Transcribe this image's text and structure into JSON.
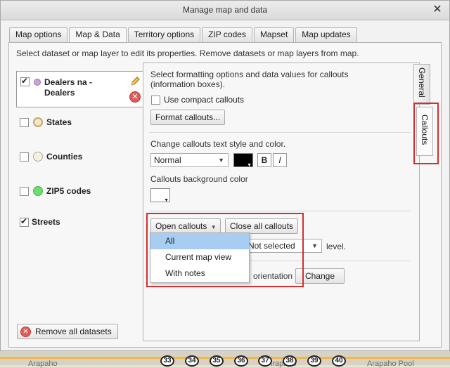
{
  "dialog": {
    "title": "Manage map and data"
  },
  "tabs": [
    {
      "label": "Map options"
    },
    {
      "label": "Map & Data",
      "active": true
    },
    {
      "label": "Territory options"
    },
    {
      "label": "ZIP codes"
    },
    {
      "label": "Mapset"
    },
    {
      "label": "Map updates"
    }
  ],
  "intro": "Select dataset or map layer to edit its properties. Remove datasets or map layers from map.",
  "datasets": [
    {
      "label_line1": "Dealers na -",
      "label_line2": "Dealers",
      "checked": true,
      "dot_color": "#c9a3d6"
    },
    {
      "label": "States",
      "checked": false,
      "dot_color": "#f5e6c8"
    },
    {
      "label": "Counties",
      "checked": false,
      "dot_color": "#f5f0df"
    },
    {
      "label": "ZIP5 codes",
      "checked": false,
      "dot_color": "#6fdc6f"
    },
    {
      "label": "Streets",
      "checked": true
    }
  ],
  "remove_all_label": "Remove all datasets",
  "props": {
    "intro_line1": "Select formatting options and data values for callouts",
    "intro_line2": "(information boxes).",
    "compact_label": "Use compact callouts",
    "format_button": "Format callouts...",
    "style_label": "Change callouts text style and color.",
    "font_style_value": "Normal",
    "text_color": "#000000",
    "bold_label": "B",
    "italic_label": "I",
    "bg_label": "Callouts background color",
    "bg_color": "#ffffff",
    "open_callouts": "Open callouts",
    "close_all_callouts": "Close all callouts",
    "level_select_value": "Not selected",
    "level_suffix": "level.",
    "orientation_text": "orientation",
    "change_button": "Change"
  },
  "vertical_tabs": {
    "general": "General",
    "callouts": "Callouts"
  },
  "open_menu": {
    "items": [
      "All",
      "Current map view",
      "With notes"
    ],
    "highlighted": "All"
  },
  "map": {
    "street_left": "Arapaho",
    "street_mid": "Arapaho",
    "street_right": "Arapaho Pool",
    "shields": [
      "33",
      "34",
      "35",
      "36",
      "37",
      "38",
      "39",
      "40"
    ]
  }
}
